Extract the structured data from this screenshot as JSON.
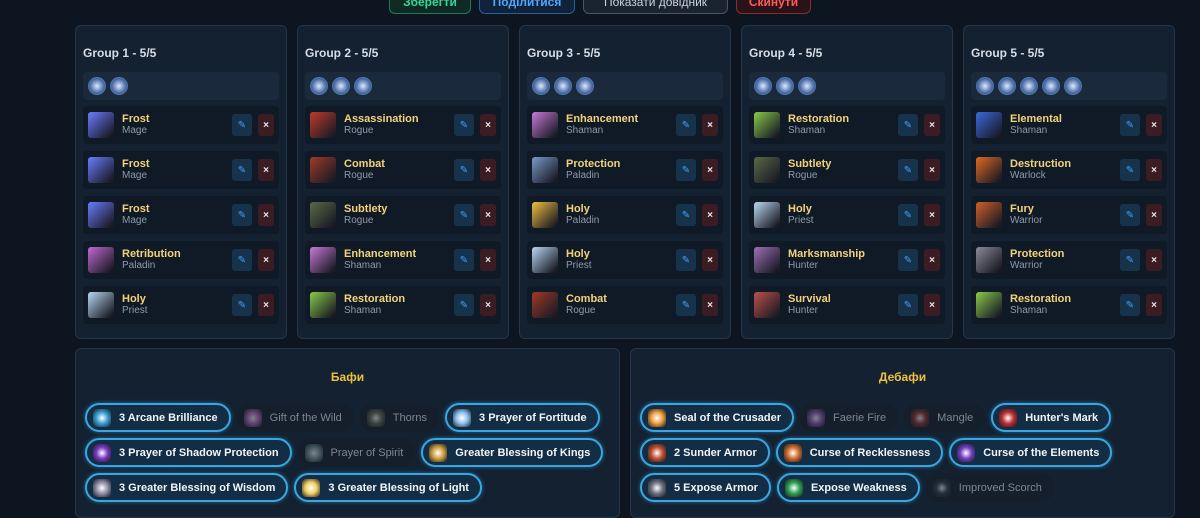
{
  "toolbar": {
    "save_label": "Зберегти",
    "share_label": "Поділитися",
    "guide_label": "Показати довідник",
    "reset_label": "Скинути"
  },
  "groups": [
    {
      "title": "Group 1 - 5/5",
      "buff_icons": [
        "arcane-brilliance-icon",
        "prayer-of-fortitude-icon"
      ],
      "members": [
        {
          "spec": "Frost",
          "cls": "Mage",
          "icon": "frost-mage-icon",
          "color": "#6a7cff"
        },
        {
          "spec": "Frost",
          "cls": "Mage",
          "icon": "frost-mage-icon",
          "color": "#6a7cff"
        },
        {
          "spec": "Frost",
          "cls": "Mage",
          "icon": "frost-mage-icon",
          "color": "#6a7cff"
        },
        {
          "spec": "Retribution",
          "cls": "Paladin",
          "icon": "retribution-paladin-icon",
          "color": "#c06ad0"
        },
        {
          "spec": "Holy",
          "cls": "Priest",
          "icon": "holy-priest-icon",
          "color": "#b8d8f0"
        }
      ]
    },
    {
      "title": "Group 2 - 5/5",
      "buff_icons": [
        "blessing-of-kings-icon",
        "shadow-protection-icon",
        "totem-icon"
      ],
      "members": [
        {
          "spec": "Assassination",
          "cls": "Rogue",
          "icon": "assassination-rogue-icon",
          "color": "#c23a2a"
        },
        {
          "spec": "Combat",
          "cls": "Rogue",
          "icon": "combat-rogue-icon",
          "color": "#a13a28"
        },
        {
          "spec": "Subtlety",
          "cls": "Rogue",
          "icon": "subtlety-rogue-icon",
          "color": "#5a6a48"
        },
        {
          "spec": "Enhancement",
          "cls": "Shaman",
          "icon": "enhancement-shaman-icon",
          "color": "#c87ad8"
        },
        {
          "spec": "Restoration",
          "cls": "Shaman",
          "icon": "restoration-shaman-icon",
          "color": "#8acb4a"
        }
      ]
    },
    {
      "title": "Group 3 - 5/5",
      "buff_icons": [
        "blessing-of-kings-icon",
        "shadow-protection-icon",
        "prayer-of-fortitude-icon"
      ],
      "members": [
        {
          "spec": "Enhancement",
          "cls": "Shaman",
          "icon": "enhancement-shaman-icon",
          "color": "#c87ad8"
        },
        {
          "spec": "Protection",
          "cls": "Paladin",
          "icon": "protection-paladin-icon",
          "color": "#7a9ac8"
        },
        {
          "spec": "Holy",
          "cls": "Paladin",
          "icon": "holy-paladin-icon",
          "color": "#f0c040"
        },
        {
          "spec": "Holy",
          "cls": "Priest",
          "icon": "holy-priest-icon",
          "color": "#b8d8f0"
        },
        {
          "spec": "Combat",
          "cls": "Rogue",
          "icon": "combat-rogue-icon",
          "color": "#a13a28"
        }
      ]
    },
    {
      "title": "Group 4 - 5/5",
      "buff_icons": [
        "blessing-of-kings-icon",
        "totem-icon",
        "trueshot-aura-icon"
      ],
      "members": [
        {
          "spec": "Restoration",
          "cls": "Shaman",
          "icon": "restoration-shaman-icon",
          "color": "#8acb4a"
        },
        {
          "spec": "Subtlety",
          "cls": "Rogue",
          "icon": "subtlety-rogue-icon",
          "color": "#5a6a48"
        },
        {
          "spec": "Holy",
          "cls": "Priest",
          "icon": "holy-priest-icon",
          "color": "#b8d8f0"
        },
        {
          "spec": "Marksmanship",
          "cls": "Hunter",
          "icon": "marksmanship-hunter-icon",
          "color": "#a070b8"
        },
        {
          "spec": "Survival",
          "cls": "Hunter",
          "icon": "survival-hunter-icon",
          "color": "#c0504a"
        }
      ]
    },
    {
      "title": "Group 5 - 5/5",
      "buff_icons": [
        "blessing-of-kings-icon",
        "battle-shout-icon",
        "demon-armor-icon",
        "strength-icon",
        "totem-icon"
      ],
      "members": [
        {
          "spec": "Elemental",
          "cls": "Shaman",
          "icon": "elemental-shaman-icon",
          "color": "#3a6ae0"
        },
        {
          "spec": "Destruction",
          "cls": "Warlock",
          "icon": "destruction-warlock-icon",
          "color": "#e06a20"
        },
        {
          "spec": "Fury",
          "cls": "Warrior",
          "icon": "fury-warrior-icon",
          "color": "#d0602a"
        },
        {
          "spec": "Protection",
          "cls": "Warrior",
          "icon": "protection-warrior-icon",
          "color": "#8a8a9a"
        },
        {
          "spec": "Restoration",
          "cls": "Shaman",
          "icon": "restoration-shaman-icon",
          "color": "#8acb4a"
        }
      ]
    }
  ],
  "member_actions": {
    "edit_icon": "pencil-icon",
    "delete_glyph": "×"
  },
  "buffs": {
    "title": "Бафи",
    "items": [
      {
        "label": "3 Arcane Brilliance",
        "active": true,
        "icon": "arcane-brilliance-icon",
        "color": "#3aa0d0"
      },
      {
        "label": "Gift of the Wild",
        "active": false,
        "icon": "gift-of-the-wild-icon",
        "color": "#c070c0"
      },
      {
        "label": "Thorns",
        "active": false,
        "icon": "thorns-icon",
        "color": "#707050"
      },
      {
        "label": "3 Prayer of Fortitude",
        "active": true,
        "icon": "prayer-of-fortitude-icon",
        "color": "#90c0f0"
      },
      {
        "label": "3 Prayer of Shadow Protection",
        "active": true,
        "icon": "shadow-protection-icon",
        "color": "#7a3ac0"
      },
      {
        "label": "Prayer of Spirit",
        "active": false,
        "icon": "prayer-of-spirit-icon",
        "color": "#80a0a0"
      },
      {
        "label": "Greater Blessing of Kings",
        "active": true,
        "icon": "blessing-of-kings-icon",
        "color": "#d0a040"
      },
      {
        "label": "3 Greater Blessing of Wisdom",
        "active": true,
        "icon": "blessing-of-wisdom-icon",
        "color": "#9090a8"
      },
      {
        "label": "3 Greater Blessing of Light",
        "active": true,
        "icon": "blessing-of-light-icon",
        "color": "#f0d060"
      }
    ]
  },
  "debuffs": {
    "title": "Дебафи",
    "items": [
      {
        "label": "Seal of the Crusader",
        "active": true,
        "icon": "seal-of-the-crusader-icon",
        "color": "#f0a040"
      },
      {
        "label": "Faerie Fire",
        "active": false,
        "icon": "faerie-fire-icon",
        "color": "#a060c0"
      },
      {
        "label": "Mangle",
        "active": false,
        "icon": "mangle-icon",
        "color": "#a03030"
      },
      {
        "label": "Hunter's Mark",
        "active": true,
        "icon": "hunters-mark-icon",
        "color": "#c03030"
      },
      {
        "label": "2 Sunder Armor",
        "active": true,
        "icon": "sunder-armor-icon",
        "color": "#c05030"
      },
      {
        "label": "Curse of Recklessness",
        "active": true,
        "icon": "curse-of-recklessness-icon",
        "color": "#d07030"
      },
      {
        "label": "Curse of the Elements",
        "active": true,
        "icon": "curse-of-the-elements-icon",
        "color": "#7040c0"
      },
      {
        "label": "5 Expose Armor",
        "active": true,
        "icon": "expose-armor-icon",
        "color": "#707080"
      },
      {
        "label": "Expose Weakness",
        "active": true,
        "icon": "expose-weakness-icon",
        "color": "#30a050"
      },
      {
        "label": "Improved Scorch",
        "active": false,
        "icon": "improved-scorch-icon",
        "color": "#304050"
      }
    ]
  }
}
